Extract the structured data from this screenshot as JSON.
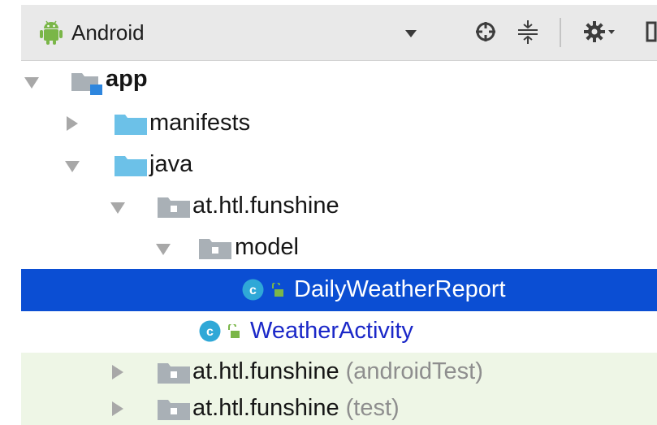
{
  "toolbar": {
    "view_label": "Android",
    "icons": [
      "android-icon",
      "target-icon",
      "collapse-all-icon",
      "gear-icon",
      "hide-icon"
    ]
  },
  "tree": {
    "app": "app",
    "manifests": "manifests",
    "java": "java",
    "package_main": "at.htl.funshine",
    "model": "model",
    "daily_weather_report": "DailyWeatherReport",
    "weather_activity": "WeatherActivity",
    "package_android_test": "at.htl.funshine",
    "package_android_test_suffix": "(androidTest)",
    "package_test": "at.htl.funshine",
    "package_test_suffix": "(test)",
    "class_badge": "c"
  },
  "colors": {
    "selection": "#0b4ed3",
    "test_tint": "#eef6e6",
    "class_icon": "#2fa8d7",
    "android_green": "#7ab648"
  }
}
